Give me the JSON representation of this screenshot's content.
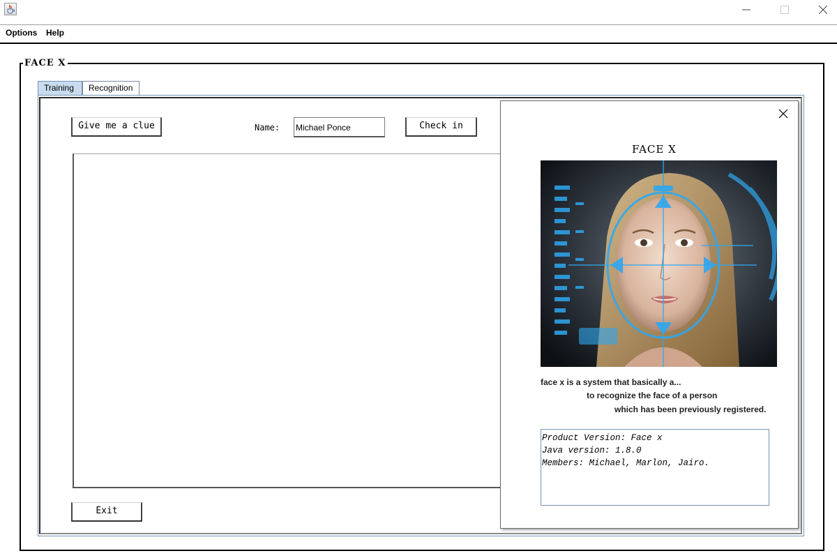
{
  "window": {
    "app_icon": "java-cup-icon",
    "controls": [
      "minimize-icon",
      "maximize-icon",
      "close-icon"
    ]
  },
  "menu": {
    "options_label": "Options",
    "help_label": "Help"
  },
  "frame": {
    "title": "FACE X"
  },
  "tabs": {
    "training_label": "Training",
    "recognition_label": "Recognition",
    "selected": "Training"
  },
  "training": {
    "clue_button_label": "Give me a clue",
    "name_label": "Name:",
    "name_value": "Michael Ponce",
    "checkin_button_label": "Check in",
    "exit_button_label": "Exit"
  },
  "about_dialog": {
    "title": "FACE X",
    "image": "face-recognition-hud-image",
    "description_lines": [
      "face x is a system that basically a...",
      "to recognize the face of a person",
      "which has been previously registered."
    ],
    "info_lines": [
      "Product Version: Face x",
      "Java version: 1.8.0",
      "Members: Michael, Marlon, Jairo."
    ]
  },
  "colors": {
    "tab_selected": "#c9dcef",
    "panel_border": "#7393b3",
    "hud_blue": "#2fa7ef"
  }
}
